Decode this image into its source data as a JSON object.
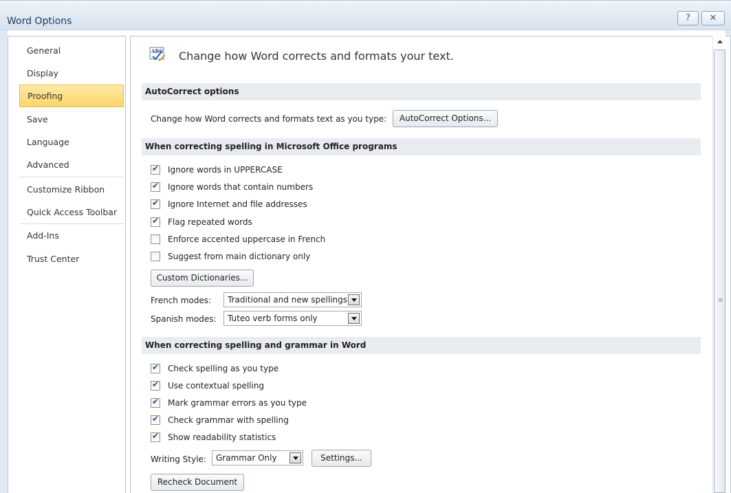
{
  "window": {
    "title": "Word Options",
    "help_label": "?",
    "close_label": "✕"
  },
  "sidebar": {
    "items": [
      {
        "label": "General"
      },
      {
        "label": "Display"
      },
      {
        "label": "Proofing",
        "active": true
      },
      {
        "label": "Save"
      },
      {
        "label": "Language"
      },
      {
        "label": "Advanced"
      },
      {
        "label": "Customize Ribbon"
      },
      {
        "label": "Quick Access Toolbar"
      },
      {
        "label": "Add-Ins"
      },
      {
        "label": "Trust Center"
      }
    ]
  },
  "main": {
    "header": "Change how Word corrects and formats your text.",
    "autocorrect": {
      "heading": "AutoCorrect options",
      "description": "Change how Word corrects and formats text as you type:",
      "button": "AutoCorrect Options..."
    },
    "office_spelling": {
      "heading": "When correcting spelling in Microsoft Office programs",
      "checkboxes": [
        {
          "label": "Ignore words in UPPERCASE",
          "checked": true
        },
        {
          "label": "Ignore words that contain numbers",
          "checked": true
        },
        {
          "label": "Ignore Internet and file addresses",
          "checked": true
        },
        {
          "label": "Flag repeated words",
          "checked": true
        },
        {
          "label": "Enforce accented uppercase in French",
          "checked": false
        },
        {
          "label": "Suggest from main dictionary only",
          "checked": false
        }
      ],
      "custom_dictionaries_button": "Custom Dictionaries...",
      "french_modes_label": "French modes:",
      "french_modes_value": "Traditional and new spellings",
      "spanish_modes_label": "Spanish modes:",
      "spanish_modes_value": "Tuteo verb forms only"
    },
    "word_spelling": {
      "heading": "When correcting spelling and grammar in Word",
      "checkboxes": [
        {
          "label": "Check spelling as you type",
          "checked": true
        },
        {
          "label": "Use contextual spelling",
          "checked": true
        },
        {
          "label": "Mark grammar errors as you type",
          "checked": true
        },
        {
          "label": "Check grammar with spelling",
          "checked": true
        },
        {
          "label": "Show readability statistics",
          "checked": true
        }
      ],
      "writing_style_label": "Writing Style:",
      "writing_style_value": "Grammar Only",
      "settings_button": "Settings...",
      "recheck_button": "Recheck Document"
    }
  },
  "icons": {
    "header_icon": "abc-spellcheck-icon"
  }
}
